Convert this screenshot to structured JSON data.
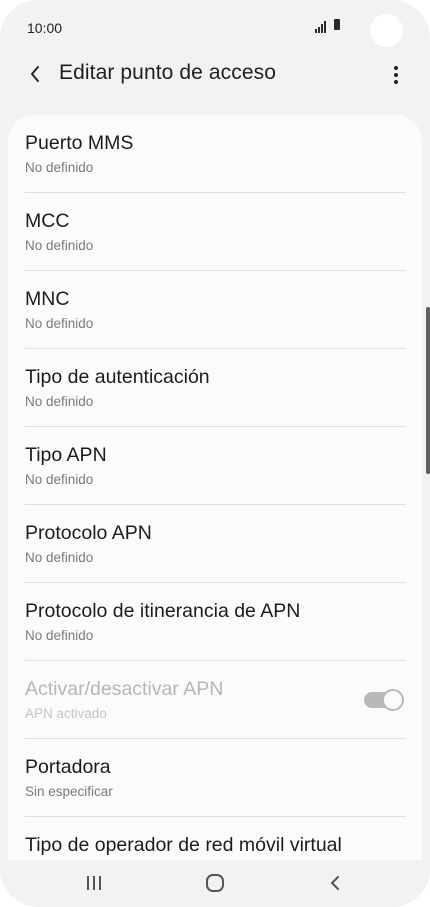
{
  "status_bar": {
    "time": "10:00",
    "icons": [
      "signal-icon",
      "battery-icon"
    ]
  },
  "app_bar": {
    "title": "Editar punto de acceso",
    "back_icon": "chevron-left-icon",
    "more_icon": "more-vert-icon"
  },
  "settings": [
    {
      "title": "Puerto MMS",
      "summary": "No definido"
    },
    {
      "title": "MCC",
      "summary": "No definido"
    },
    {
      "title": "MNC",
      "summary": "No definido"
    },
    {
      "title": "Tipo de autenticación",
      "summary": "No definido"
    },
    {
      "title": "Tipo APN",
      "summary": "No definido"
    },
    {
      "title": "Protocolo APN",
      "summary": "No definido"
    },
    {
      "title": "Protocolo de itinerancia de APN",
      "summary": "No definido"
    },
    {
      "title": "Activar/desactivar APN",
      "summary": "APN activado",
      "toggle": true,
      "toggle_state": "on",
      "disabled": true
    },
    {
      "title": "Portadora",
      "summary": "Sin especificar"
    },
    {
      "title": "Tipo de operador de red móvil virtual",
      "summary": ""
    }
  ],
  "nav_bar": {
    "icons": [
      "recents-icon",
      "home-icon",
      "back-icon"
    ]
  },
  "colors": {
    "background": "#f2f2f2",
    "card": "#fbfbfb",
    "text_primary": "#1c1c1c",
    "text_secondary": "#7a7a7a",
    "disabled": "#b6b6b6"
  }
}
